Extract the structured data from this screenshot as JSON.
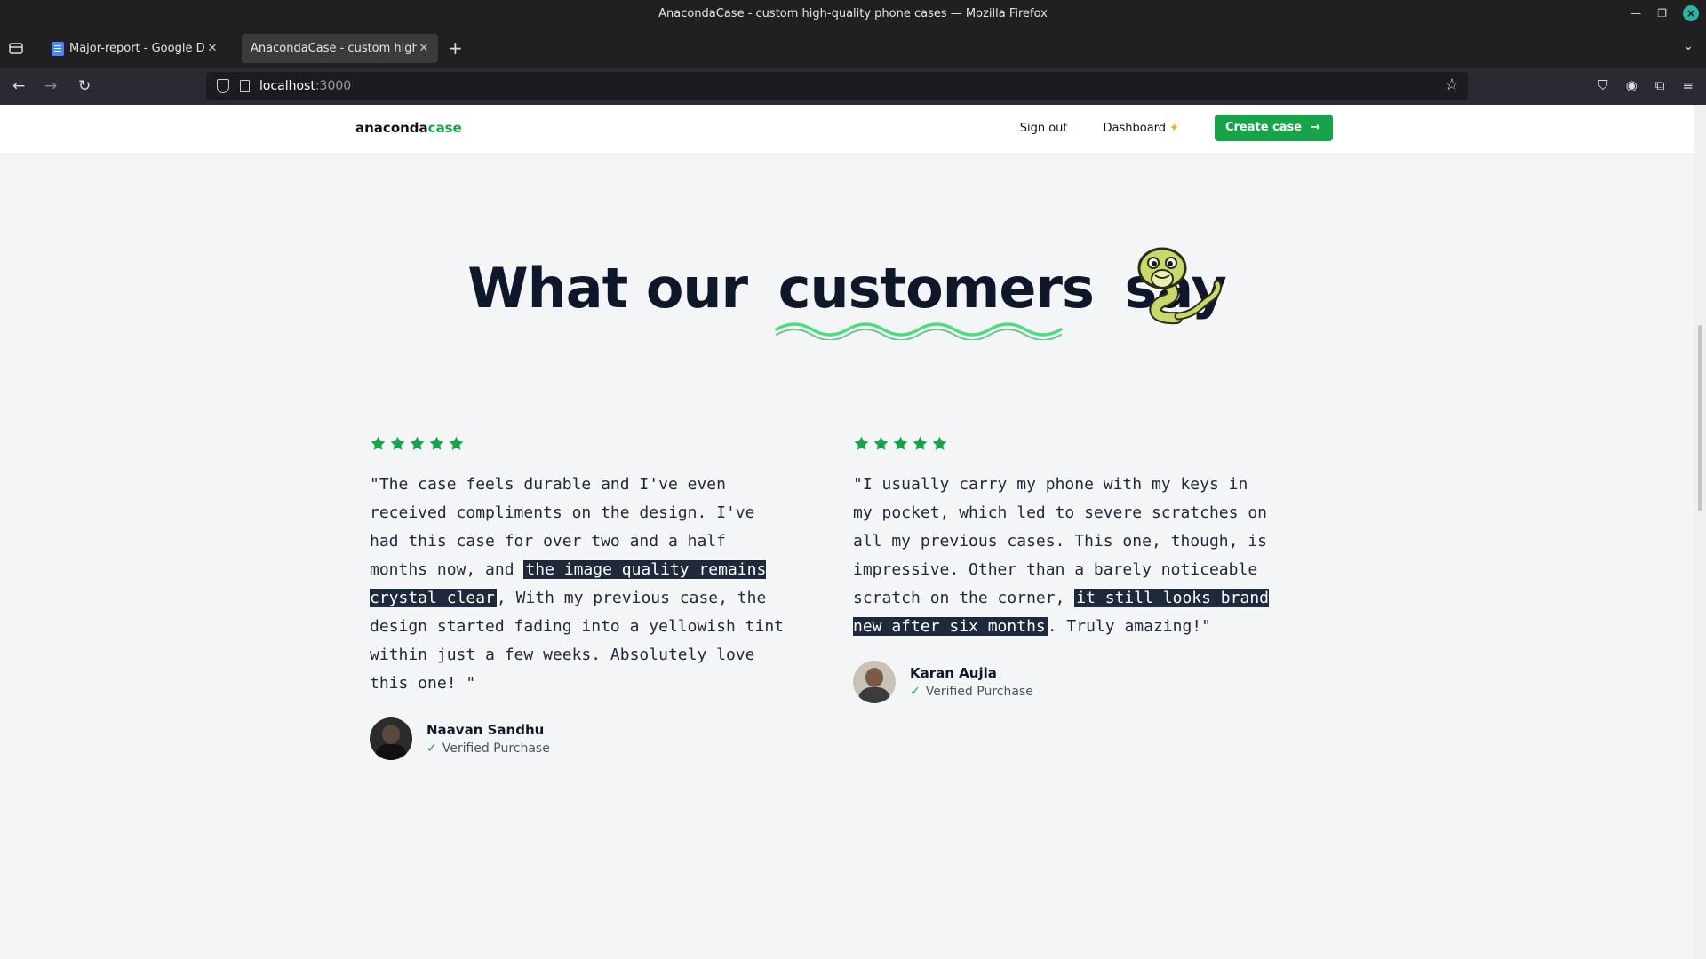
{
  "window": {
    "title": "AnacondaCase - custom high-quality phone cases — Mozilla Firefox"
  },
  "tabs": [
    {
      "label": "Major-report - Google Docs",
      "active": false
    },
    {
      "label": "AnacondaCase - custom high-q",
      "active": true
    }
  ],
  "urlbar": {
    "host": "localhost",
    "port": ":3000"
  },
  "site": {
    "logo_main": "anaconda",
    "logo_accent": "case",
    "nav": {
      "sign_out": "Sign out",
      "dashboard": "Dashboard",
      "dashboard_icon": "sparkles-icon",
      "create_case": "Create case"
    }
  },
  "section": {
    "heading_pre": "What our",
    "heading_highlight": "customers",
    "heading_post": "say"
  },
  "reviews": [
    {
      "rating": 5,
      "text_before": "\"The case feels durable and I've even received compliments on the design. I've had this case for over two and a half months now, and ",
      "highlight": "the image quality remains crystal clear",
      "text_after": ", With my previous case, the design started fading into a yellowish tint within just a few weeks. Absolutely love this one! \"",
      "name": "Naavan Sandhu",
      "verified": "Verified Purchase"
    },
    {
      "rating": 5,
      "text_before": "\"I usually carry my phone with my keys in my pocket, which led to severe scratches on all my previous cases. This one, though, is impressive. Other than a barely noticeable scratch on the corner, ",
      "highlight": "it still looks brand new after six months",
      "text_after": ". Truly amazing!\"",
      "name": "Karan Aujla",
      "verified": "Verified Purchase"
    }
  ],
  "colors": {
    "accent": "#16a34a",
    "heading": "#0f172a",
    "highlight_bg": "#1e293b"
  }
}
